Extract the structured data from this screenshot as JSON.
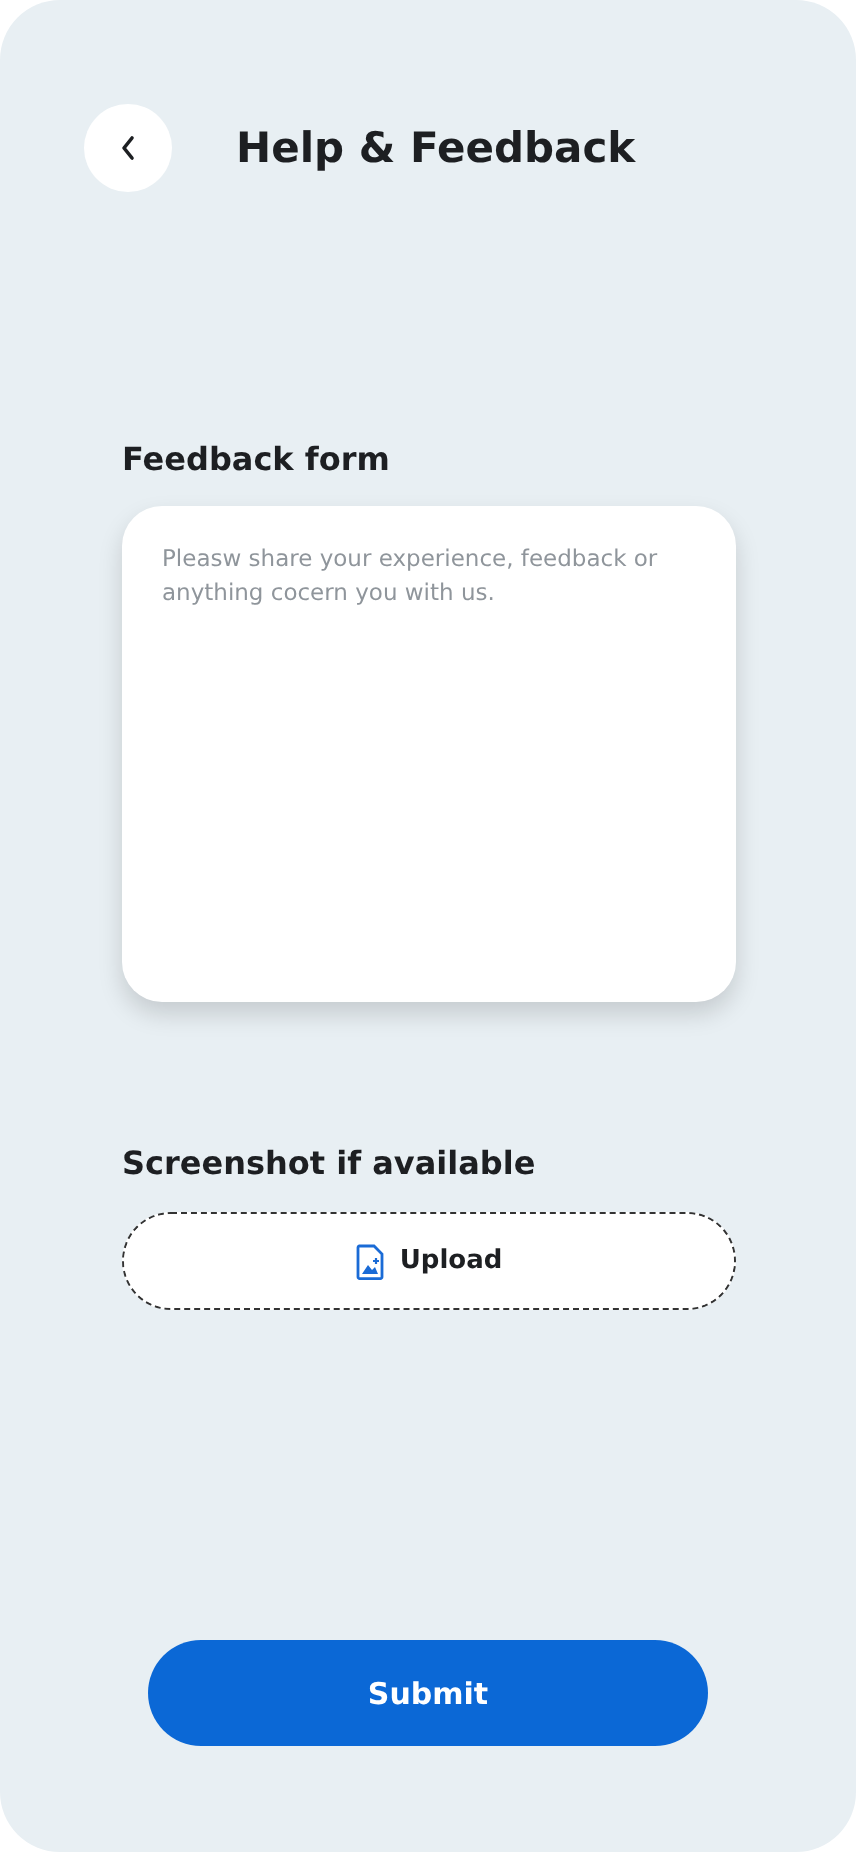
{
  "header": {
    "title": "Help & Feedback"
  },
  "feedback": {
    "label": "Feedback form",
    "placeholder": "Pleasw share your experience, feedback or anything cocern you with us."
  },
  "screenshot": {
    "label": "Screenshot if available",
    "button": "Upload"
  },
  "submit": {
    "label": "Submit"
  }
}
